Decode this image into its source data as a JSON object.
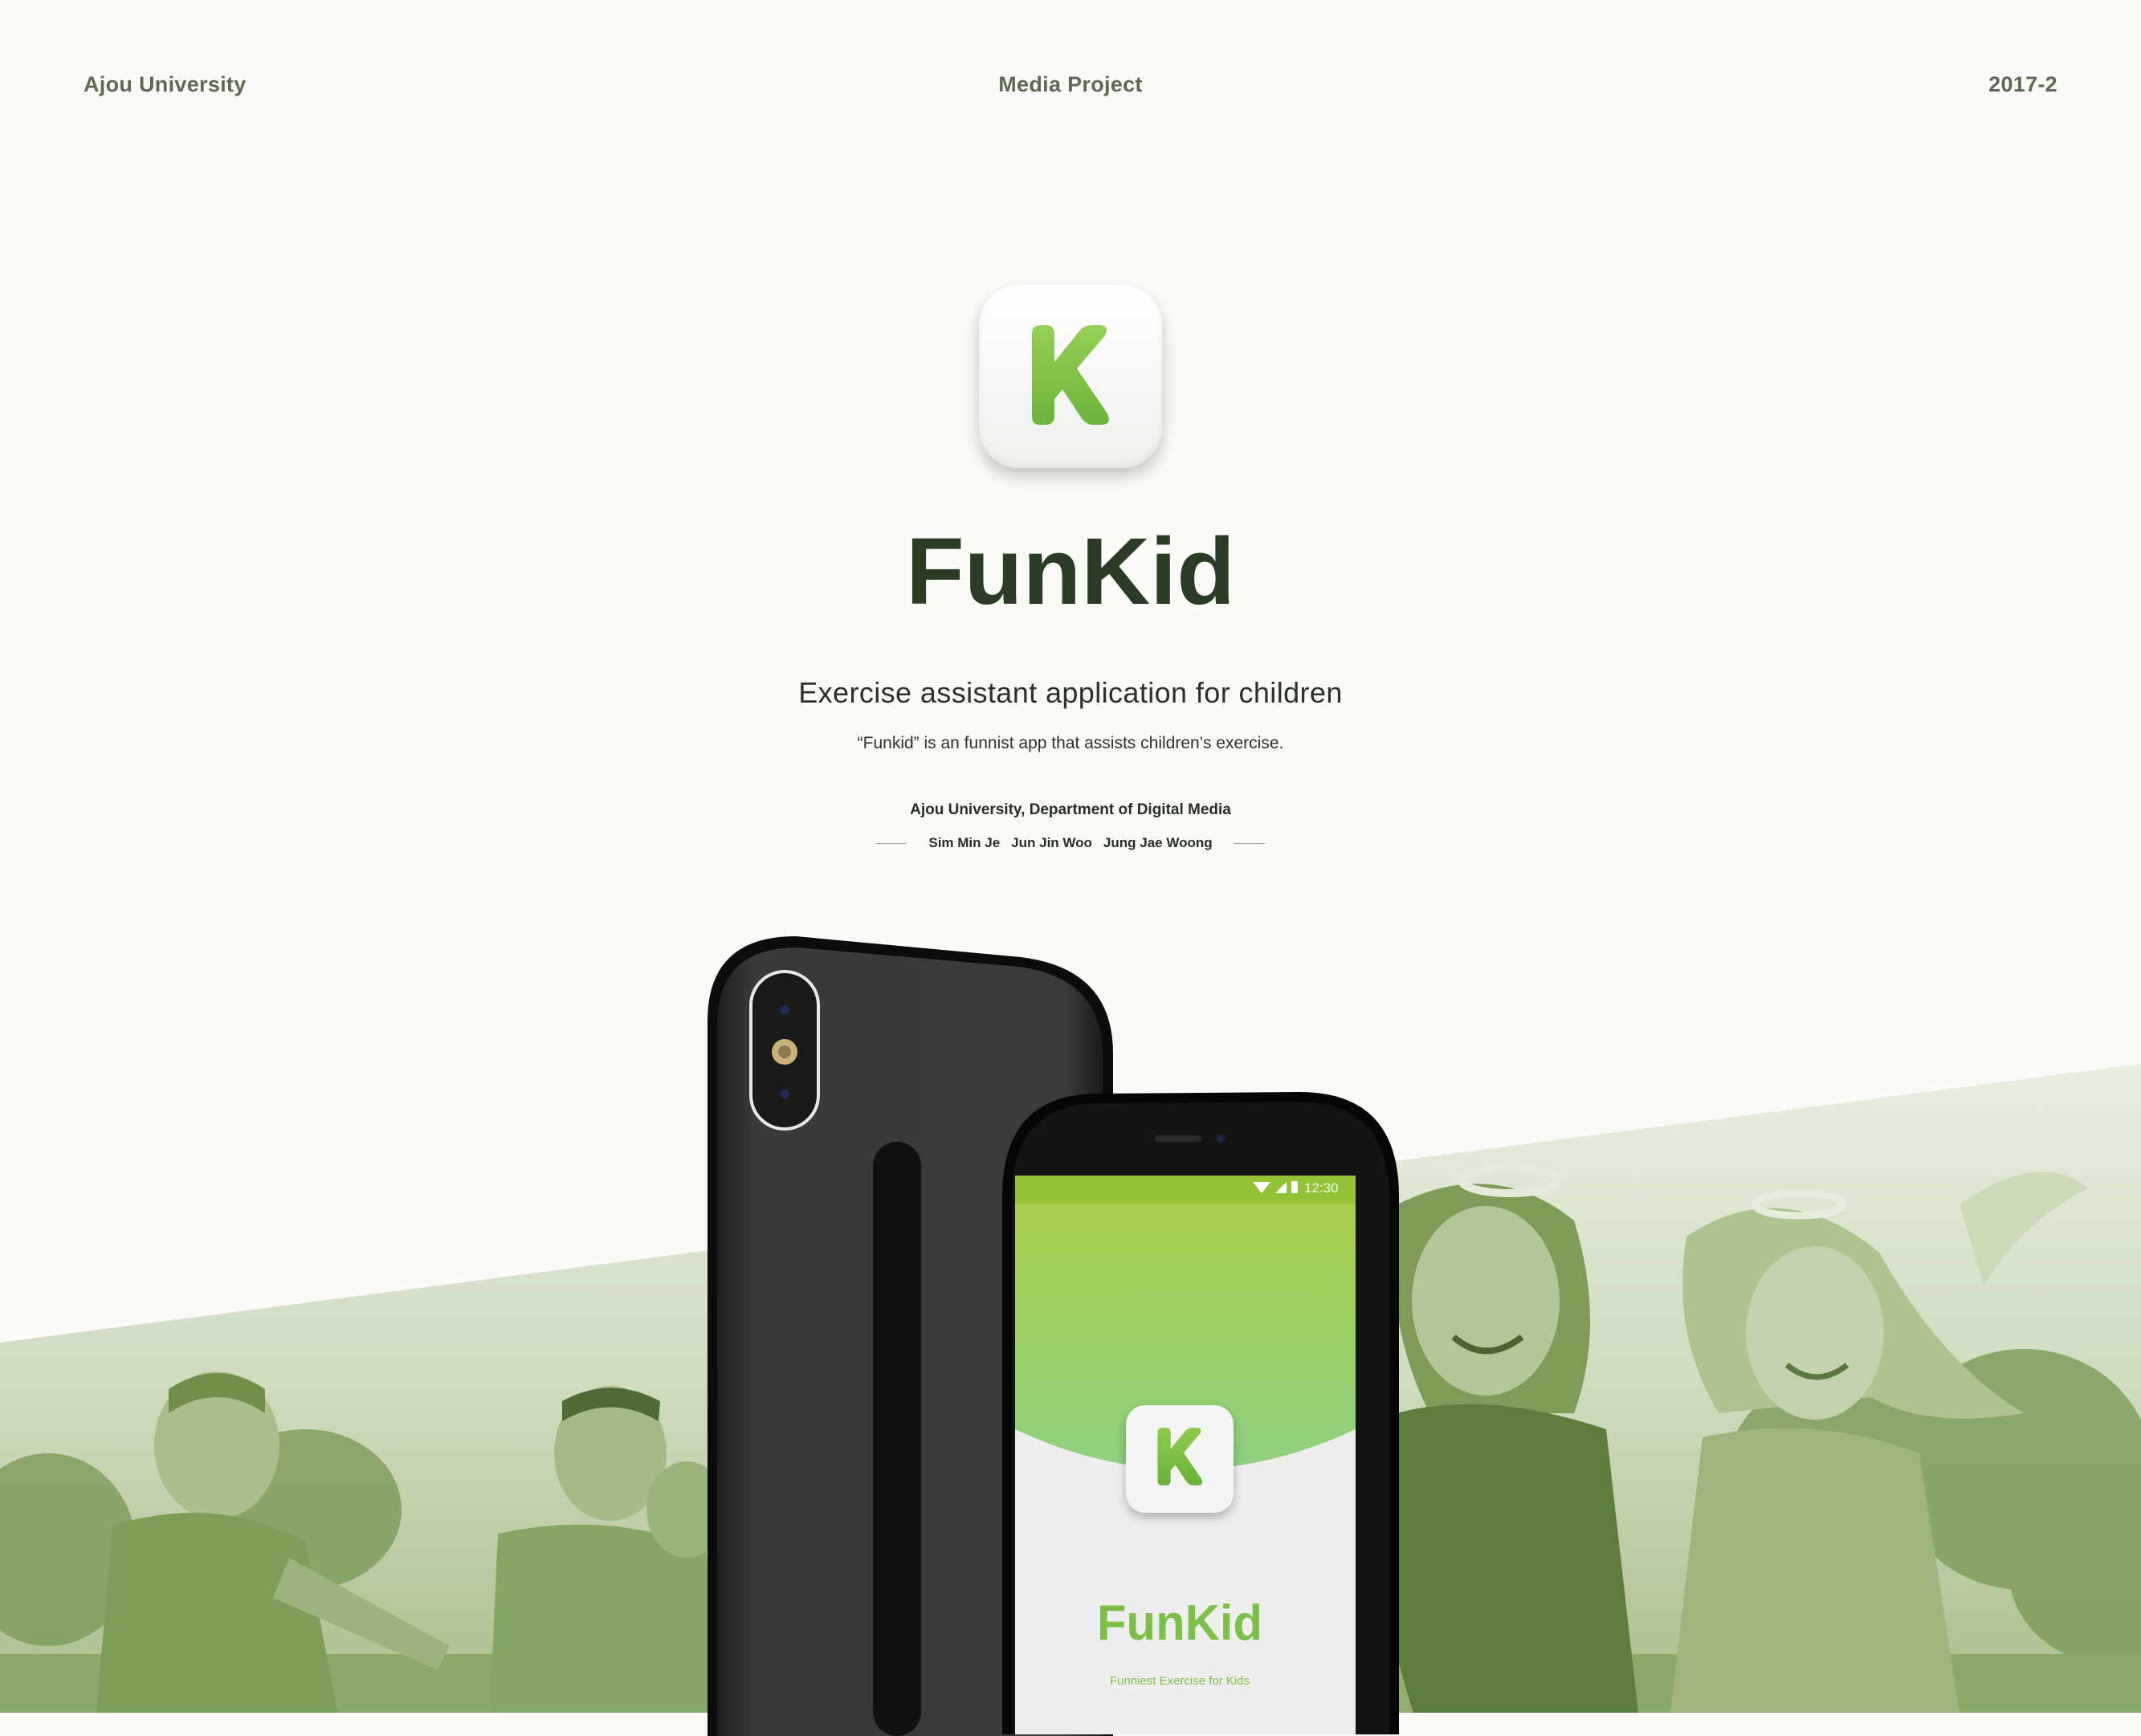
{
  "header": {
    "left": "Ajou University",
    "center": "Media Project",
    "right": "2017-2"
  },
  "brand": {
    "logo_text": "FunKid",
    "tagline": "Exercise assistant application for children",
    "description": "“Funkid” is an funnist app that assists children’s exercise.",
    "department": "Ajou University, Department of Digital Media",
    "members": [
      "Sim Min Je",
      "Jun Jin Woo",
      "Jung Jae Woong"
    ]
  },
  "phone_screen": {
    "time": "12:30",
    "logo_text": "FunKid",
    "subtitle": "Funniest Exercise for Kids"
  },
  "colors": {
    "background": "#fafbf7",
    "accent_green": "#7cc04a",
    "dark_green": "#2a3d24",
    "photo_tint": "#8fac6b"
  },
  "icons": [
    "k-logo-icon",
    "wifi-icon",
    "signal-icon",
    "battery-icon",
    "camera-icon"
  ]
}
